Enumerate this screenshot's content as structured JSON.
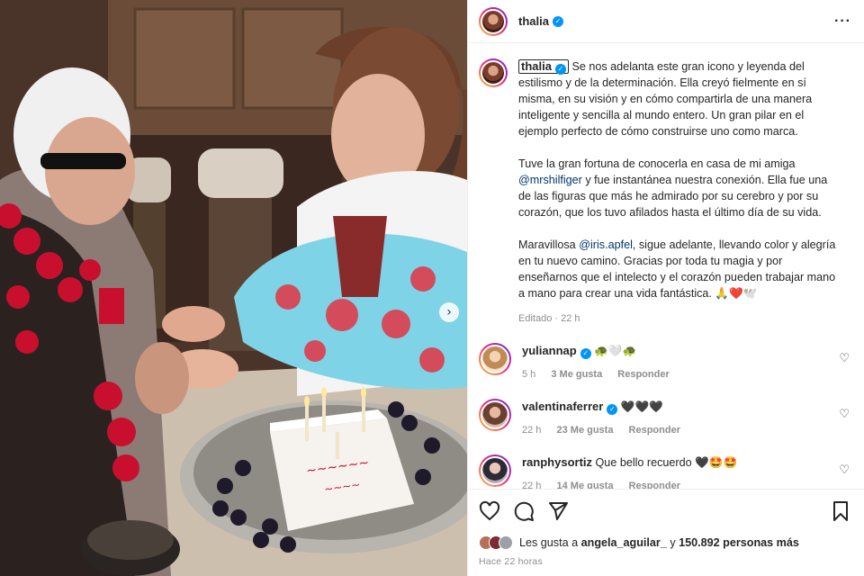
{
  "post": {
    "username": "thalia",
    "caption": {
      "p1": "Se nos adelanta este gran icono y leyenda del estilismo y de la determinación. Ella creyó fielmente en sí misma, en su visión y en cómo compartirla de una manera inteligente y sencilla al mundo entero. Un gran pilar en el ejemplo perfecto de cómo construirse uno como marca.",
      "p2_before": "Tuve la gran fortuna de conocerla en casa de mi amiga",
      "p2_mention": "@mrshilfiger",
      "p2_after": "y fue instantánea nuestra conexión. Ella fue una de las figuras que más he admirado por su cerebro y por su corazón, que los tuvo afilados hasta el último día de su vida.",
      "p3_before": "Maravillosa",
      "p3_mention": "@iris.apfel",
      "p3_after": ", sigue adelante, llevando color y alegría en tu nuevo camino. Gracias por toda tu magia y por enseñarnos que el intelecto y el corazón pueden trabajar mano a mano para crear una vida fantástica. 🙏❤️🕊️"
    },
    "caption_meta": "Editado · 22 h",
    "comments": [
      {
        "user": "yuliannap",
        "text": "🐢🤍🐢",
        "time": "5 h",
        "likes": "3 Me gusta",
        "reply": "Responder",
        "verified": true
      },
      {
        "user": "valentinaferrer",
        "text": "🖤🖤🖤",
        "time": "22 h",
        "likes": "23 Me gusta",
        "reply": "Responder",
        "verified": true
      },
      {
        "user": "ranphysortiz",
        "text": "Que bello recuerdo 🖤🤩🤩",
        "time": "22 h",
        "likes": "14 Me gusta",
        "reply": "Responder",
        "verified": false
      }
    ],
    "likes": {
      "prefix": "Les gusta a",
      "user": "angela_aguilar_",
      "middle": "y",
      "count": "150.892 personas más"
    },
    "posted_ago": "Hace 22 horas"
  },
  "colors": {
    "accent": "#0095f6",
    "mention": "#00376b",
    "muted": "#8e8e8e"
  },
  "icons": [
    "more-icon",
    "verified-icon",
    "heart-icon",
    "comment-icon",
    "share-icon",
    "bookmark-icon",
    "next-arrow-icon"
  ]
}
